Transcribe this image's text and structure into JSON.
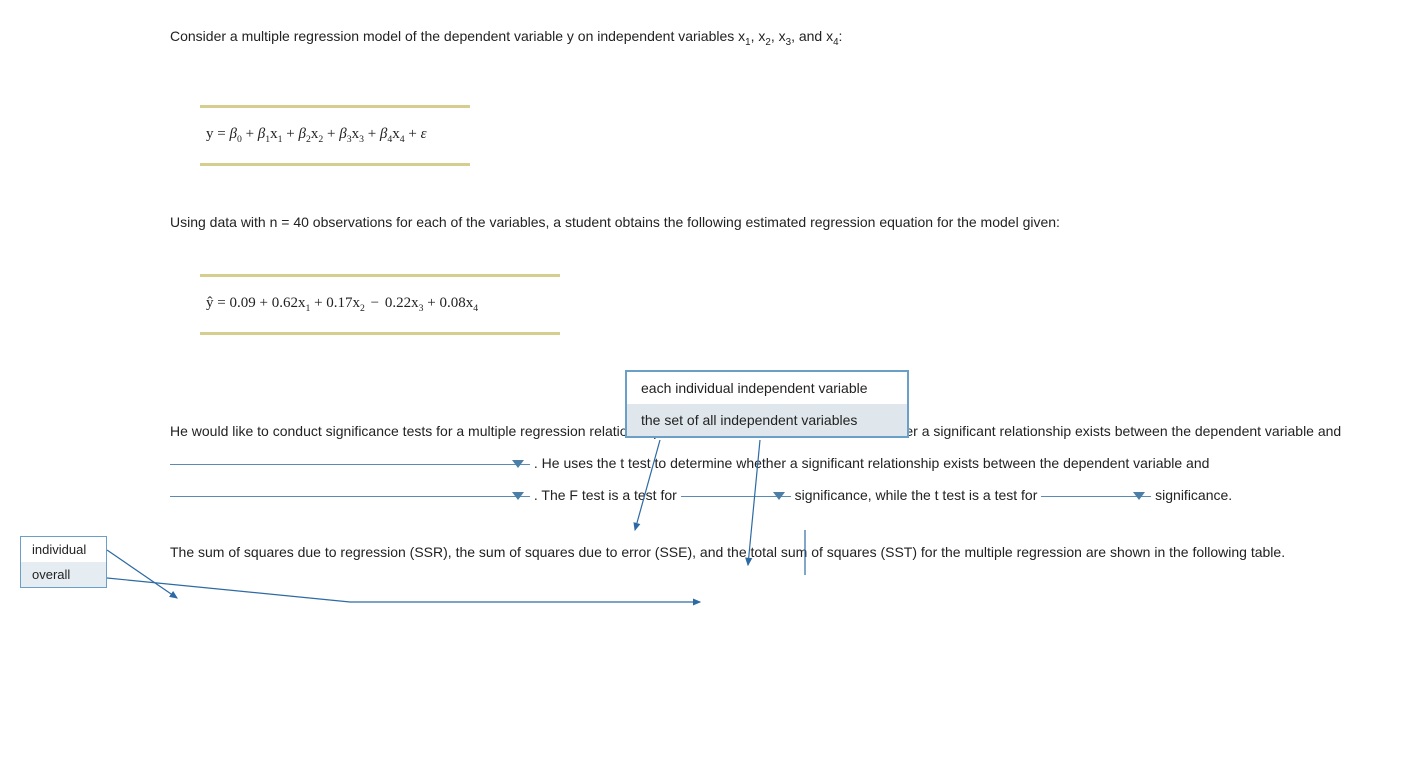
{
  "intro": {
    "line1_a": "Consider a multiple regression model of the dependent variable y on independent variables x",
    "line1_b": ", x",
    "line1_c": ", x",
    "line1_d": ", and x",
    "line1_e": ":"
  },
  "eq1": {
    "y": "y",
    "eq": " = ",
    "b0": "β",
    "s0": "0",
    "plus": " + ",
    "b1": "β",
    "s1": "1",
    "x1": "x",
    "xs1": "1",
    "b2": "β",
    "s2": "2",
    "x2": "x",
    "xs2": "2",
    "b3": "β",
    "s3": "3",
    "x3": "x",
    "xs3": "3",
    "b4": "β",
    "s4": "4",
    "x4": "x",
    "xs4": "4",
    "eps": "ε"
  },
  "mid": "Using data with n = 40 observations for each of the variables, a student obtains the following estimated regression equation for the model given:",
  "eq2": {
    "yhat": "ŷ",
    "eq": " = ",
    "c0": "0.09",
    "c1": "0.62",
    "x1": "x",
    "s1": "1",
    "c2": "0.17",
    "x2": "x",
    "s2": "2",
    "c3": "0.22",
    "x3": "x",
    "s3": "3",
    "c4": "0.08",
    "x4": "x",
    "s4": "4",
    "plus": " + ",
    "minus": " − "
  },
  "body": {
    "t1": "He would like to conduct significance tests for a multiple regression relationship. He uses the F test to determine whether a significant relationship exists between the dependent variable and ",
    "t2": " . He uses the t test to determine whether a significant relationship exists between the dependent variable and ",
    "t3": " . The F test is a test for ",
    "t4": " significance, while the t test is a test for ",
    "t5": " significance."
  },
  "closing": "The sum of squares due to regression (SSR), the sum of squares due to error (SSE), and the total sum of squares (SST) for the multiple regression are shown in the following table.",
  "dropdown_main": {
    "opt1": "each individual independent variable",
    "opt2": "the set of all independent variables"
  },
  "dropdown_left": {
    "opt1": "individual",
    "opt2": "overall"
  }
}
